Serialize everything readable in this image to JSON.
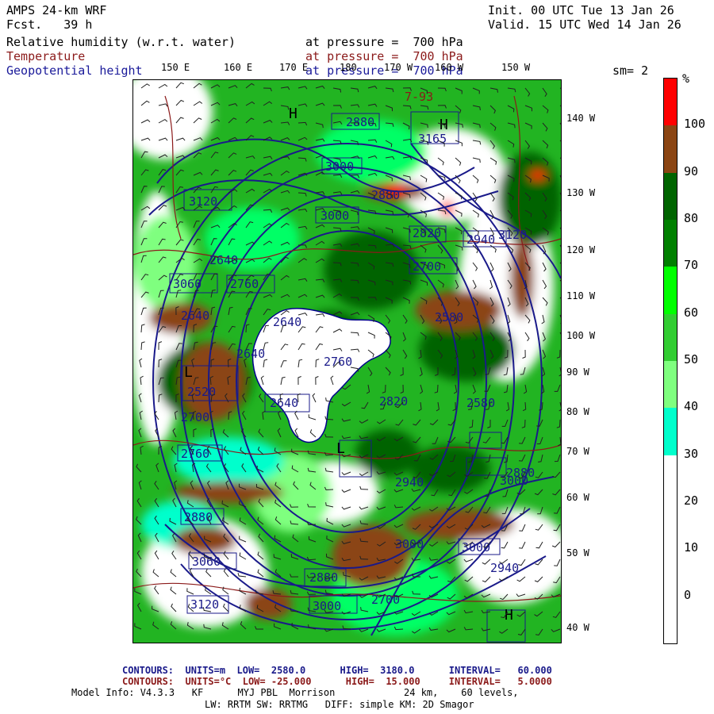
{
  "header": {
    "model": "AMPS 24-km WRF",
    "fcst_label": "Fcst.",
    "fcst_value": "39 h",
    "init": "Init. 00 UTC Tue 13 Jan 26",
    "valid": "Valid. 15 UTC Wed 14 Jan 26",
    "fields": [
      {
        "name": "Relative humidity (w.r.t. water)",
        "level": "at pressure =  700 hPa",
        "color": "#000000"
      },
      {
        "name": "Temperature",
        "level": "at pressure =  700 hPa",
        "color": "#8b1a1a"
      },
      {
        "name": "Geopotential height",
        "level": "at pressure =  700 hPa",
        "color": "#1a1a9a"
      }
    ],
    "smoothing": "sm= 2"
  },
  "longitude_labels": [
    "150 E",
    "160 E",
    "170 E",
    "180",
    "170 W",
    "160 W",
    "150 W"
  ],
  "latitude_labels": [
    "140 W",
    "130 W",
    "120 W",
    "110 W",
    "100 W",
    "90 W",
    "80 W",
    "70 W",
    "60 W",
    "50 W",
    "40 W"
  ],
  "colorbar": {
    "unit": "%",
    "ticks": [
      "100",
      "90",
      "80",
      "70",
      "60",
      "50",
      "40",
      "30",
      "20",
      "10",
      "0"
    ],
    "colors": [
      "#ff0000",
      "#8b4513",
      "#006400",
      "#008000",
      "#00ff00",
      "#32cd32",
      "#7fff7f",
      "#00ffcc",
      "#ffffff",
      "#ffffff",
      "#ffffff",
      "#ffffff"
    ]
  },
  "map": {
    "height_labels": [
      "2880",
      "3120",
      "3165",
      "3000",
      "2880",
      "3120",
      "3060",
      "3000",
      "2640",
      "2820",
      "2940",
      "2700",
      "2760",
      "2580",
      "2640",
      "2640",
      "2520",
      "2640",
      "2580",
      "2760",
      "2940",
      "3000",
      "2760",
      "2640",
      "2880",
      "3060",
      "2820",
      "2880",
      "3000",
      "2700",
      "3000",
      "3120",
      "3000",
      "2880",
      "2700",
      "2940"
    ],
    "temp_labels": [
      "7-93"
    ],
    "pressure_centers": [
      "H",
      "L",
      "H",
      "L",
      "H"
    ]
  },
  "footer": {
    "line1": "CONTOURS:  UNITS=m  LOW=  2580.0      HIGH=  3180.0      INTERVAL=   60.000",
    "line2": "CONTOURS:  UNITS=°C  LOW= -25.000      HIGH=  15.000     INTERVAL=   5.0000",
    "line3": "Model Info: V4.3.3   KF      MYJ PBL  Morrison            24 km,    60 levels,",
    "line4": "LW: RRTM SW: RRTMG   DIFF: simple KM: 2D Smagor"
  }
}
